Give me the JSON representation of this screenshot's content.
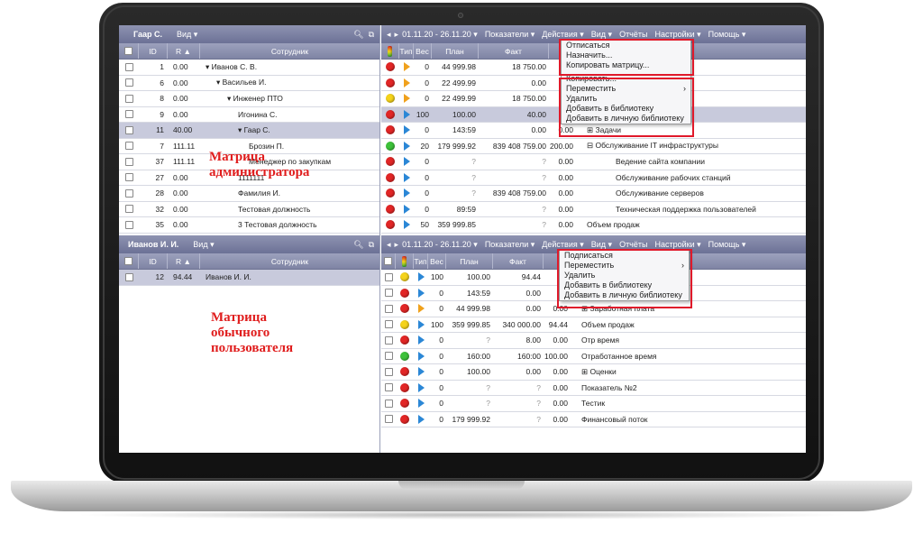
{
  "colors": {
    "accent": "#7a7fa0",
    "selection": "#c8cadc",
    "highlight": "#e0192a"
  },
  "admin_pane": {
    "user": "Гаар С.",
    "view": "Вид ▾",
    "tools": [
      "search-icon",
      "export-icon"
    ],
    "columns": [
      "ID",
      "R ▲",
      "Сотрудник"
    ],
    "rows": [
      {
        "id": "1",
        "r": "0.00",
        "name": "▾ Иванов С. В.",
        "indent": 0
      },
      {
        "id": "6",
        "r": "0.00",
        "name": "▾ Васильев И.",
        "indent": 1
      },
      {
        "id": "8",
        "r": "0.00",
        "name": "▾ Инженер ПТО",
        "indent": 2
      },
      {
        "id": "9",
        "r": "0.00",
        "name": "Игонина С.",
        "indent": 3
      },
      {
        "id": "11",
        "r": "40.00",
        "name": "▾ Гаар С.",
        "indent": 3
      },
      {
        "id": "7",
        "r": "111.11",
        "name": "Брозин П.",
        "indent": 4
      },
      {
        "id": "37",
        "r": "111.11",
        "name": "Менеджер по закупкам",
        "indent": 4
      },
      {
        "id": "27",
        "r": "0.00",
        "name": "1111111",
        "indent": 3
      },
      {
        "id": "28",
        "r": "0.00",
        "name": "Фамилия И.",
        "indent": 3
      },
      {
        "id": "32",
        "r": "0.00",
        "name": "Тестовая должность",
        "indent": 3
      },
      {
        "id": "35",
        "r": "0.00",
        "name": "3 Тестовая должность",
        "indent": 3
      }
    ]
  },
  "user_pane": {
    "user": "Иванов И. И.",
    "view": "Вид ▾",
    "columns": [
      "ID",
      "R ▲",
      "Сотрудник"
    ],
    "rows": [
      {
        "id": "12",
        "r": "94.44",
        "name": "Иванов И. И."
      }
    ]
  },
  "toolbar": {
    "period": "01.11.20 - 26.11.20 ▾",
    "menus": [
      "Показатели ▾",
      "Действия ▾",
      "Вид ▾",
      "Отчёты",
      "Настройки ▾",
      "Помощь ▾"
    ]
  },
  "metrics_columns": [
    "Тип",
    "Вес",
    "План",
    "Факт"
  ],
  "admin_metrics": [
    {
      "light": "red",
      "type": "orange",
      "w": "0",
      "plan": "44 999.98",
      "fact": "18 750.00",
      "pct": "",
      "name": "",
      "sel": false
    },
    {
      "light": "red",
      "type": "orange",
      "w": "0",
      "plan": "22 499.99",
      "fact": "0.00",
      "pct": "",
      "name": "",
      "sel": false
    },
    {
      "light": "yellow",
      "type": "orange",
      "w": "0",
      "plan": "22 499.99",
      "fact": "18 750.00",
      "pct": "",
      "name": "",
      "sel": false
    },
    {
      "light": "red",
      "type": "blue",
      "w": "100",
      "plan": "100.00",
      "fact": "40.00",
      "pct": "",
      "name": "",
      "sel": true
    },
    {
      "light": "red",
      "type": "blue",
      "w": "0",
      "plan": "143:59",
      "fact": "0.00",
      "pct": "0.00",
      "name": "⊞ Задачи",
      "sel": false
    },
    {
      "light": "green",
      "type": "blue",
      "w": "20",
      "plan": "179 999.92",
      "fact": "839 408 759.00",
      "pct": "200.00",
      "name": "⊟ Обслуживание IT инфраструктуры",
      "sel": false
    },
    {
      "light": "red",
      "type": "blue",
      "w": "0",
      "plan": "?",
      "fact": "?",
      "pct": "0.00",
      "name": "Ведение сайта компании",
      "sel": false
    },
    {
      "light": "red",
      "type": "blue",
      "w": "0",
      "plan": "?",
      "fact": "?",
      "pct": "0.00",
      "name": "Обслуживание рабочих станций",
      "sel": false
    },
    {
      "light": "red",
      "type": "blue",
      "w": "0",
      "plan": "?",
      "fact": "839 408 759.00",
      "pct": "0.00",
      "name": "Обслуживание серверов",
      "sel": false
    },
    {
      "light": "red",
      "type": "blue",
      "w": "0",
      "plan": "89:59",
      "fact": "?",
      "pct": "0.00",
      "name": "Техническая поддержка пользователей",
      "sel": false
    },
    {
      "light": "red",
      "type": "blue",
      "w": "50",
      "plan": "359 999.85",
      "fact": "?",
      "pct": "0.00",
      "name": "Объем продаж",
      "sel": false
    }
  ],
  "user_metrics": [
    {
      "light": "yellow",
      "type": "blue",
      "w": "100",
      "plan": "100.00",
      "fact": "94.44",
      "pct": "",
      "name": "",
      "sel": false
    },
    {
      "light": "red",
      "type": "blue",
      "w": "0",
      "plan": "143:59",
      "fact": "0.00",
      "pct": "",
      "name": "",
      "sel": false
    },
    {
      "light": "red",
      "type": "orange",
      "w": "0",
      "plan": "44 999.98",
      "fact": "0.00",
      "pct": "0.00",
      "name": "⊞ Заработная плата",
      "sel": false
    },
    {
      "light": "yellow",
      "type": "blue",
      "w": "100",
      "plan": "359 999.85",
      "fact": "340 000.00",
      "pct": "94.44",
      "name": "Объем продаж",
      "sel": false
    },
    {
      "light": "red",
      "type": "blue",
      "w": "0",
      "plan": "?",
      "fact": "8.00",
      "pct": "0.00",
      "name": "Отр время",
      "sel": false
    },
    {
      "light": "green",
      "type": "blue",
      "w": "0",
      "plan": "160:00",
      "fact": "160:00",
      "pct": "100.00",
      "name": "Отработанное время",
      "sel": false
    },
    {
      "light": "red",
      "type": "blue",
      "w": "0",
      "plan": "100.00",
      "fact": "0.00",
      "pct": "0.00",
      "name": "⊞ Оценки",
      "sel": false
    },
    {
      "light": "red",
      "type": "blue",
      "w": "0",
      "plan": "?",
      "fact": "?",
      "pct": "0.00",
      "name": "Показатель №2",
      "sel": false
    },
    {
      "light": "red",
      "type": "blue",
      "w": "0",
      "plan": "?",
      "fact": "?",
      "pct": "0.00",
      "name": "Тестик",
      "sel": false
    },
    {
      "light": "red",
      "type": "blue",
      "w": "0",
      "plan": "179 999.92",
      "fact": "?",
      "pct": "0.00",
      "name": "Финансовый поток",
      "sel": false
    }
  ],
  "admin_menu": {
    "group1": [
      "Отписаться",
      "Назначить...",
      "Копировать матрицу..."
    ],
    "group2": [
      "Копировать...",
      "Переместить",
      "Удалить",
      "Добавить в библиотеку",
      "Добавить в личную библиотеку"
    ],
    "submenu_arrow": "›"
  },
  "user_menu": {
    "items": [
      "Подписаться",
      "Переместить",
      "Удалить",
      "Добавить в библиотеку",
      "Добавить в личную библиотеку"
    ],
    "submenu_arrow": "›"
  },
  "labels": {
    "admin": [
      "Матрица",
      "администратора"
    ],
    "user": [
      "Матрица",
      "обычного",
      "пользователя"
    ]
  }
}
